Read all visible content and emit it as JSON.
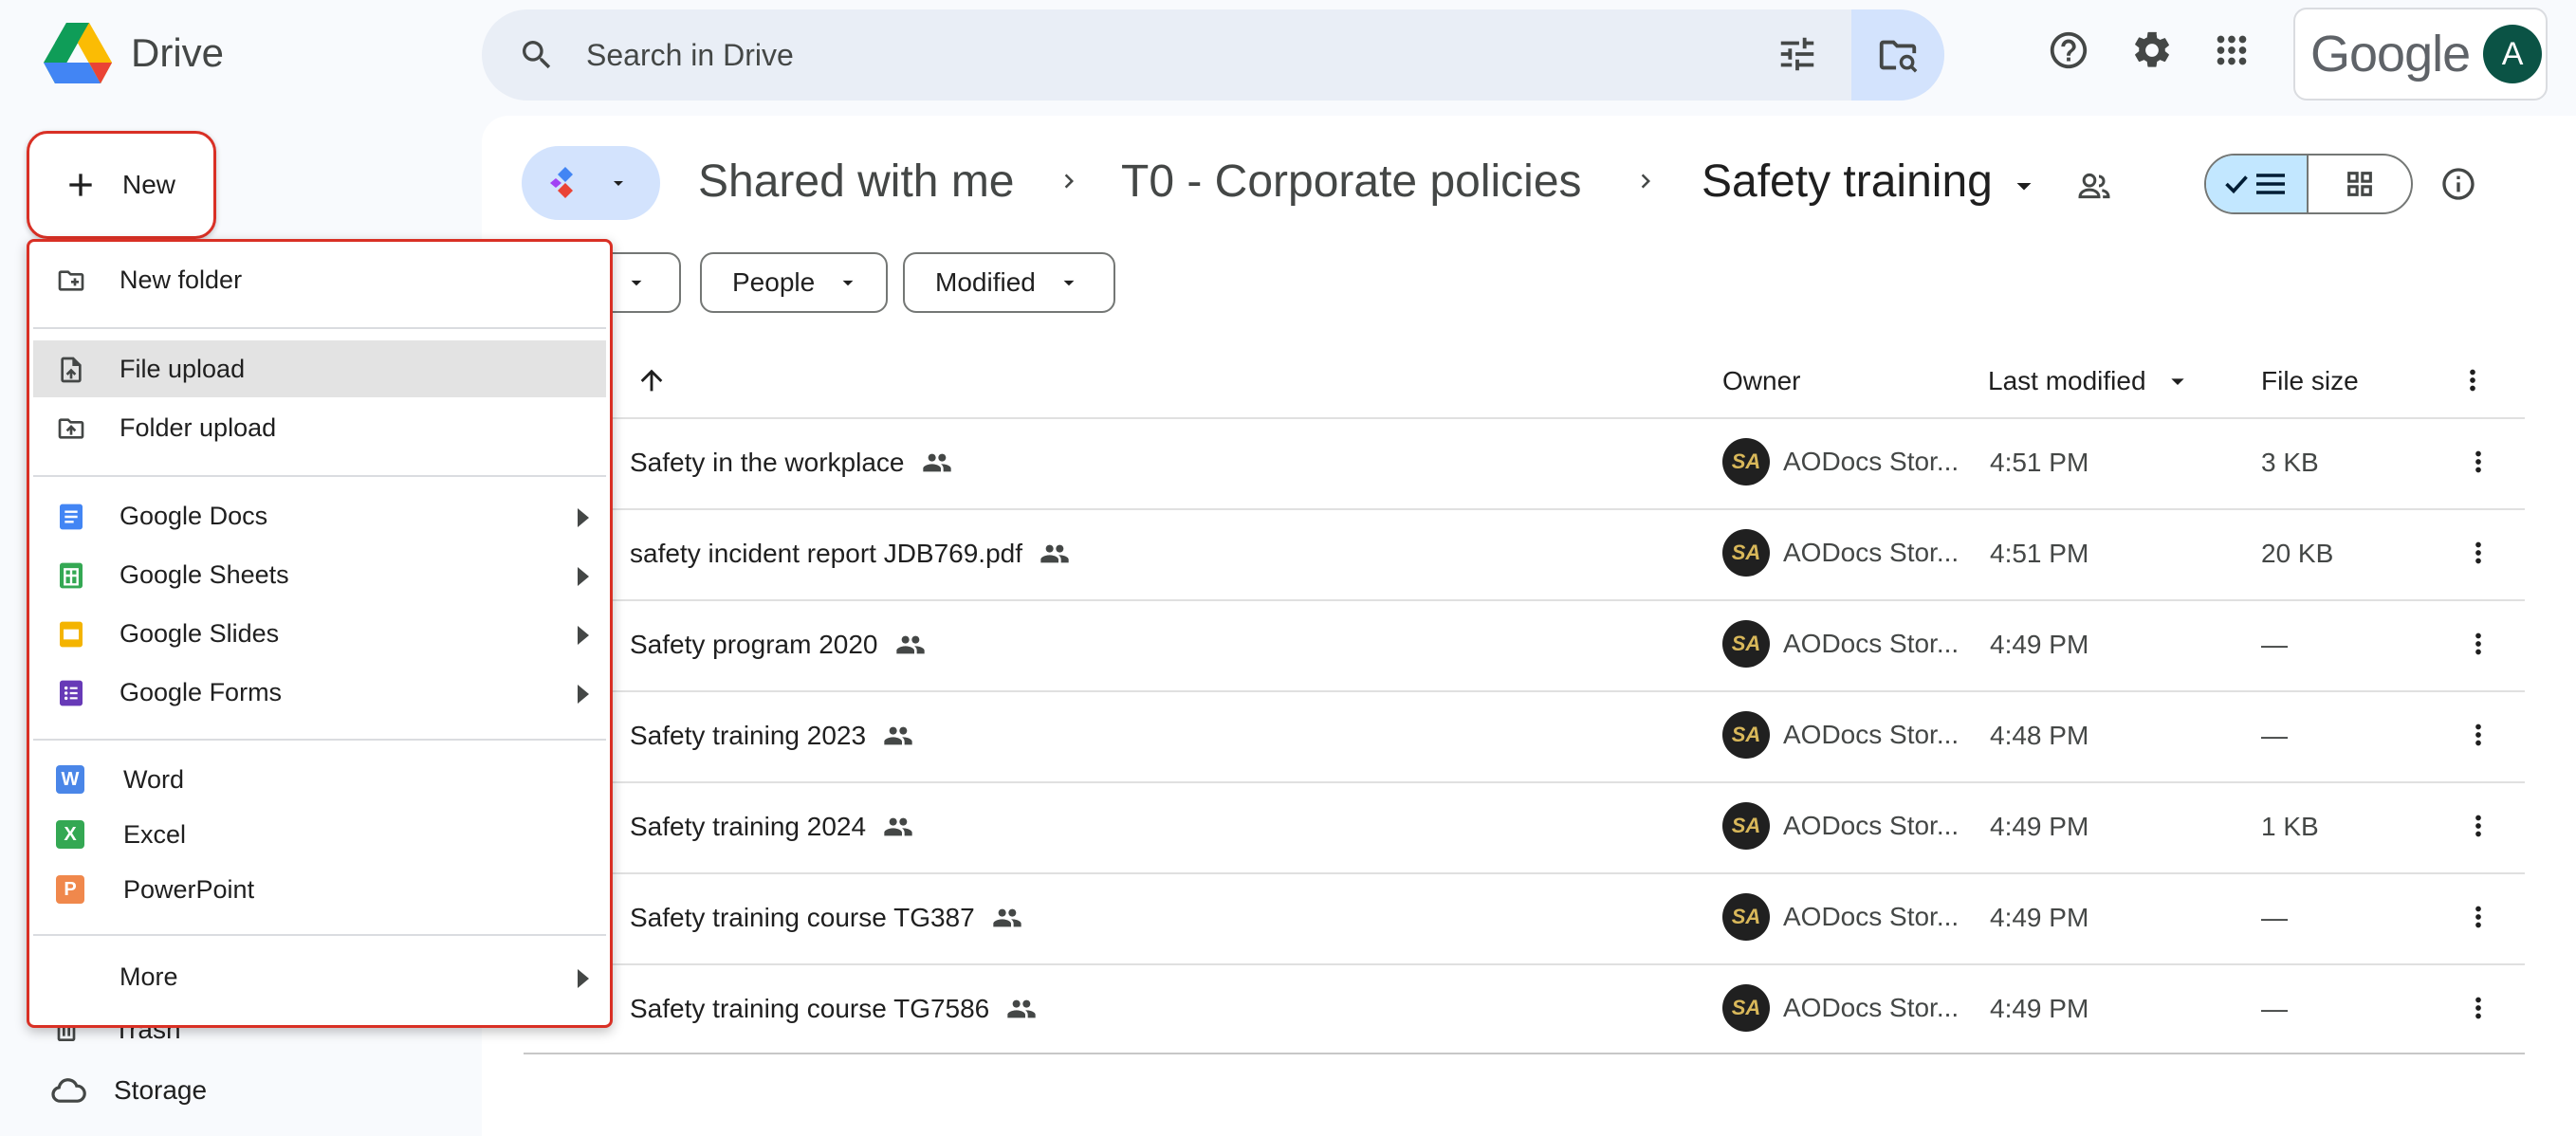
{
  "header": {
    "app_name": "Drive",
    "search_placeholder": "Search in Drive",
    "google_wordmark": "Google",
    "avatar_letter": "A"
  },
  "nav": {
    "trash": "Trash",
    "storage": "Storage"
  },
  "new_button": {
    "label": "New"
  },
  "new_menu": {
    "items": [
      {
        "label": "New folder",
        "icon": "new-folder-icon"
      },
      {
        "label": "File upload",
        "icon": "file-upload-icon",
        "highlighted": true
      },
      {
        "label": "Folder upload",
        "icon": "folder-upload-icon"
      },
      {
        "label": "Google Docs",
        "icon": "google-docs-icon",
        "submenu": true
      },
      {
        "label": "Google Sheets",
        "icon": "google-sheets-icon",
        "submenu": true
      },
      {
        "label": "Google Slides",
        "icon": "google-slides-icon",
        "submenu": true
      },
      {
        "label": "Google Forms",
        "icon": "google-forms-icon",
        "submenu": true
      },
      {
        "label": "Word",
        "icon": "word-icon",
        "badge": "W",
        "color": "#4a86e8"
      },
      {
        "label": "Excel",
        "icon": "excel-icon",
        "badge": "X",
        "color": "#34a853"
      },
      {
        "label": "PowerPoint",
        "icon": "powerpoint-icon",
        "badge": "P",
        "color": "#f0884c"
      },
      {
        "label": "More",
        "submenu": true
      }
    ]
  },
  "breadcrumb": {
    "items": [
      "Shared with me",
      "T0 - Corporate policies"
    ],
    "current": "Safety training"
  },
  "filters": {
    "people": "People",
    "modified": "Modified"
  },
  "table": {
    "columns": {
      "owner": "Owner",
      "last_modified": "Last modified",
      "file_size": "File size"
    },
    "rows": [
      {
        "name": "Safety in the workplace",
        "owner": "AODocs Stor...",
        "owner_initials": "SA",
        "modified": "4:51 PM",
        "size": "3 KB"
      },
      {
        "name": "safety incident report JDB769.pdf",
        "owner": "AODocs Stor...",
        "owner_initials": "SA",
        "modified": "4:51 PM",
        "size": "20 KB"
      },
      {
        "name": "Safety program 2020",
        "owner": "AODocs Stor...",
        "owner_initials": "SA",
        "modified": "4:49 PM",
        "size": "—"
      },
      {
        "name": "Safety training 2023",
        "owner": "AODocs Stor...",
        "owner_initials": "SA",
        "modified": "4:48 PM",
        "size": "—"
      },
      {
        "name": "Safety training 2024",
        "owner": "AODocs Stor...",
        "owner_initials": "SA",
        "modified": "4:49 PM",
        "size": "1 KB"
      },
      {
        "name": "Safety training course TG387",
        "owner": "AODocs Stor...",
        "owner_initials": "SA",
        "modified": "4:49 PM",
        "size": "—"
      },
      {
        "name": "Safety training course TG7586",
        "owner": "AODocs Stor...",
        "owner_initials": "SA",
        "modified": "4:49 PM",
        "size": "—"
      }
    ]
  },
  "colors": {
    "accent": "#d93025",
    "search_bg": "#e9eef6",
    "selected_toggle": "#c2e7ff"
  }
}
